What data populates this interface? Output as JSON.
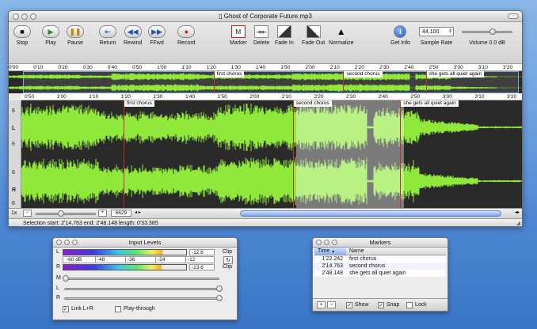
{
  "window": {
    "title": "Ghost of Corporate Future.mp3"
  },
  "toolbar": {
    "stop": "Stop",
    "play": "Play",
    "pause": "Pause",
    "return": "Return",
    "rewind": "Rewind",
    "ffwd": "FFwd",
    "record": "Record",
    "marker": "Marker",
    "delete": "Delete",
    "fade_in": "Fade In",
    "fade_out": "Fade Out",
    "normalize": "Normalize",
    "get_info": "Get Info",
    "sample_rate_label": "Sample Rate",
    "sample_rate_value": "44,100",
    "volume_label": "Volume 0.0 dB",
    "volume_level": 0.62
  },
  "overview_ruler": [
    "0'00",
    "0'10",
    "0'20",
    "0'30",
    "0'40",
    "0'50",
    "1'00",
    "1'10",
    "1'20",
    "1'30",
    "1'40",
    "1'50",
    "2'00",
    "2'10",
    "2'20",
    "2'30",
    "2'40",
    "2'50",
    "3'00",
    "3'10",
    "3'20"
  ],
  "main_ruler": [
    "0'50",
    "1'00",
    "1'10",
    "1'20",
    "1'30",
    "1'40",
    "1'50",
    "2'00",
    "2'10",
    "2'20",
    "2'30",
    "2'40",
    "2'50",
    "3'00",
    "3'10",
    "3'20"
  ],
  "markers": [
    {
      "name": "first chorus",
      "time": "1'22.242"
    },
    {
      "name": "second chorus",
      "time": "2'14.763"
    },
    {
      "name": "she gets all quiet again",
      "time": "2'48.148"
    }
  ],
  "channels": {
    "left": "L",
    "right": "R",
    "tick_top": "6",
    "tick_bottom": "6"
  },
  "zoom": {
    "level": "1x",
    "value": "6629"
  },
  "status": "Selection start: 2'14.763  end: 2'48.148  length: 0'33.385",
  "input_levels": {
    "title": "Input Levels",
    "l": "L",
    "r": "R",
    "m": "M",
    "scale": [
      "-60 dB",
      "-48",
      "-36",
      "-24",
      "-12"
    ],
    "l_value": "-12.6",
    "r_value": "-13.6",
    "clip": "Clip",
    "link_label": "Link L+R",
    "link_checked": true,
    "playthrough_label": "Play-through",
    "playthrough_checked": false
  },
  "markers_panel": {
    "title": "Markers",
    "col_time": "Time",
    "col_name": "Name",
    "show": "Show",
    "snap": "Snap",
    "lock": "Lock",
    "show_checked": true,
    "snap_checked": true,
    "lock_checked": false
  }
}
